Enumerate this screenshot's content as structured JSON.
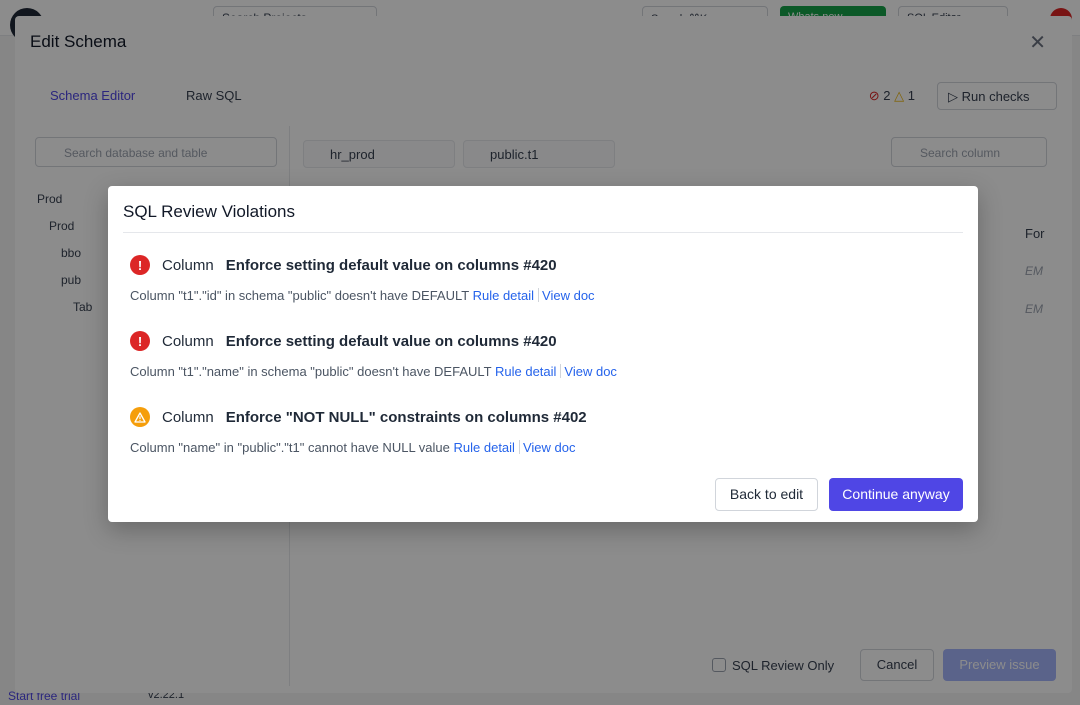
{
  "app": {
    "search_label": "Search Projects",
    "pill1_label": "Search ⌘K",
    "pill2_label": "Whats new",
    "pill3_label": "SQL Editor",
    "start_trial": "Start free trial",
    "version": "v2.22.1"
  },
  "panel": {
    "title": "Edit Schema",
    "tabs": [
      {
        "label": "Schema Editor"
      },
      {
        "label": "Raw SQL"
      }
    ],
    "checks": {
      "errors": "2",
      "warnings": "1"
    },
    "run_checks_label": "Run checks",
    "db_search_placeholder": "Search database and table",
    "tree": [
      {
        "label": "Prod"
      },
      {
        "label": "Prod"
      },
      {
        "label": "bbo"
      },
      {
        "label": "pub"
      },
      {
        "label": "Tab"
      }
    ],
    "file_tabs": [
      {
        "label": "hr_prod"
      },
      {
        "label": "public.t1"
      }
    ],
    "col_search_placeholder": "Search column",
    "col_header": "For",
    "grid_cells": [
      "EM",
      "EM"
    ],
    "review_only_label": "SQL Review Only",
    "cancel_label": "Cancel",
    "preview_label": "Preview issue"
  },
  "modal": {
    "title": "SQL Review Violations",
    "violations": [
      {
        "level": "error",
        "type": "Column",
        "title": "Enforce setting default value on columns #420",
        "message": "Column \"t1\".\"id\" in schema \"public\" doesn't have DEFAULT",
        "rule_detail_label": "Rule detail",
        "view_doc_label": "View doc"
      },
      {
        "level": "error",
        "type": "Column",
        "title": "Enforce setting default value on columns #420",
        "message": "Column \"t1\".\"name\" in schema \"public\" doesn't have DEFAULT",
        "rule_detail_label": "Rule detail",
        "view_doc_label": "View doc"
      },
      {
        "level": "warning",
        "type": "Column",
        "title": "Enforce \"NOT NULL\" constraints on columns #402",
        "message": "Column \"name\" in \"public\".\"t1\" cannot have NULL value",
        "rule_detail_label": "Rule detail",
        "view_doc_label": "View doc"
      }
    ],
    "back_label": "Back to edit",
    "continue_label": "Continue anyway"
  },
  "colors": {
    "accent": "#4f46e5",
    "error": "#dc2626",
    "warning": "#f59e0b",
    "link": "#2563eb"
  }
}
